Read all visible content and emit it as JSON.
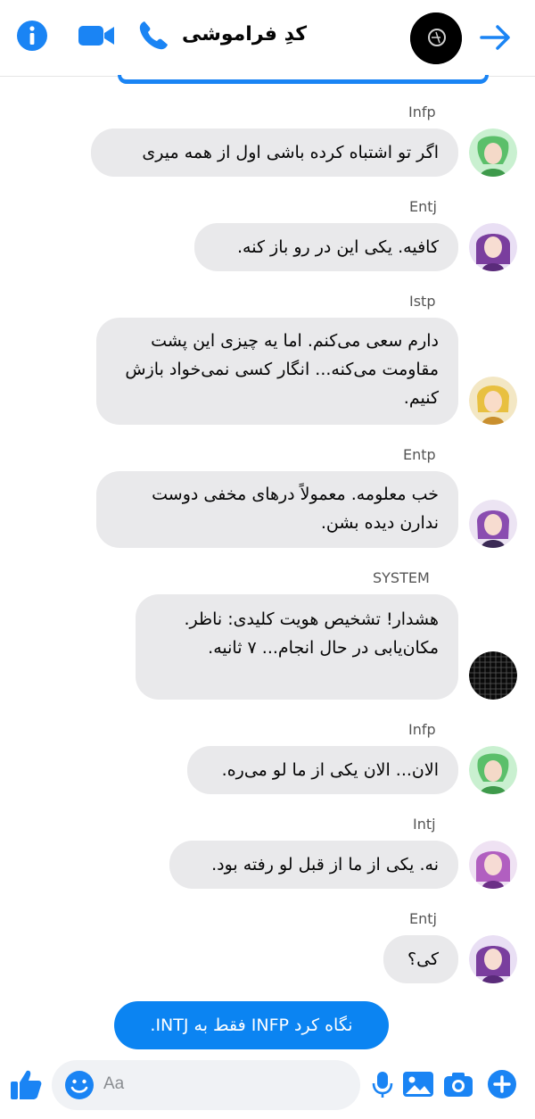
{
  "colors": {
    "accent": "#1a84f4",
    "bubble_gray": "#e9e9eb",
    "my_bubble": "#0b84f2"
  },
  "header": {
    "title": "کدِ فراموشی",
    "icons": [
      "info-icon",
      "video-call-icon",
      "phone-icon",
      "group-avatar",
      "forward-arrow-icon"
    ]
  },
  "messages": [
    {
      "sender": "Infp",
      "text": "اگر تو اشتباه کرده باشی اول از همه میری"
    },
    {
      "sender": "Entj",
      "text": "کافیه. یکی این در رو باز کنه."
    },
    {
      "sender": "Istp",
      "text": "دارم سعی می‌کنم. اما یه چیزی این پشت مقاومت می‌کنه... انگار کسی نمی‌خواد بازش کنیم."
    },
    {
      "sender": "Entp",
      "text": "خب معلومه. معمولاً درهای مخفی دوست ندارن دیده بشن."
    },
    {
      "sender": "SYSTEM",
      "text": "هشدار! تشخیص هویت کلیدی: ناظر. مکان‌یابی در حال انجام... ۷ ثانیه."
    },
    {
      "sender": "Infp",
      "text": "الان... الان یکی از ما لو می‌ره."
    },
    {
      "sender": "Intj",
      "text": "نه. یکی از ما از قبل لو رفته بود."
    },
    {
      "sender": "Entj",
      "text": "کی؟"
    }
  ],
  "my_message": {
    "text": "نگاه کرد INFP فقط به INTJ."
  },
  "composer": {
    "placeholder": "Aa",
    "icons": [
      "like-icon",
      "emoji-icon",
      "microphone-icon",
      "image-icon",
      "camera-icon",
      "plus-icon"
    ]
  }
}
